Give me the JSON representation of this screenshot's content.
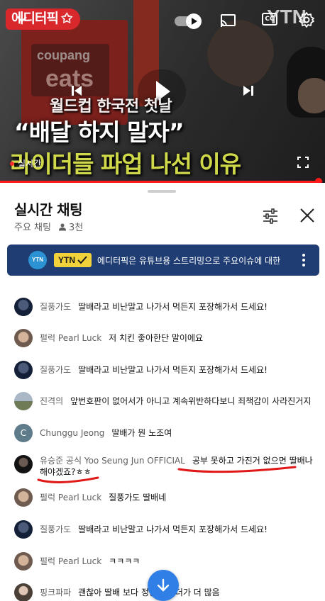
{
  "video": {
    "channel_logo": "에디터픽",
    "watermark": "YTN",
    "subtitle_line1": "월드컵 한국전 첫날",
    "subtitle_line2": "“배달 하지 말자”",
    "subtitle_line3": "라이더들 파업 나선 이유",
    "live_label": "실시간",
    "progress": 0.98,
    "icons": [
      "chevron-down-icon",
      "autoplay-toggle",
      "cast-icon",
      "captions-icon",
      "settings-gear-icon",
      "previous-icon",
      "play-icon",
      "next-icon",
      "fullscreen-icon"
    ],
    "colors": {
      "accent": "#ff1a1a",
      "logo_bg": "#d8282c",
      "subtitle_yellow": "#cfd94a"
    }
  },
  "chat": {
    "title": "실시간 채팅",
    "mode": "주요 채팅",
    "viewers": "3천",
    "pinned": {
      "avatar_text": "YTN",
      "badge": "YTN",
      "text": "에디터픽은 유튜브용 스트리밍으로 주요이슈에 대한 방"
    },
    "messages": [
      {
        "author": "질풍가도",
        "text": "딸배라고 비난말고 나가서 먹든지 포장해가서 드세요!",
        "avatar": "dark"
      },
      {
        "author": "펄럭 Pearl Luck",
        "text": "저 치킨 좋아한단 말이에요",
        "avatar": "face"
      },
      {
        "author": "질풍가도",
        "text": "딸배라고 비난말고 나가서 먹든지 포장해가서 드세요!",
        "avatar": "dark"
      },
      {
        "author": "진격의",
        "text": "앞번호판이 없어서가 아니고 계속위반하다보니 죄책감이 사라진거지",
        "avatar": "land"
      },
      {
        "author": "Chunggu Jeong",
        "text": "딸배가 뭔 노조여",
        "avatar": "C"
      },
      {
        "author": "유승준 공식 Yoo Seung Jun OFFICIAL",
        "text": "공부 못하고 가진거 없으면 딸배나 해야겠죠?ㅎㅎ",
        "avatar": "black"
      },
      {
        "author": "펄럭 Pearl Luck",
        "text": "질풍가도 딸배네",
        "avatar": "face"
      },
      {
        "author": "질풍가도",
        "text": "딸배라고 비난말고 나가서 먹든지 포장해가서 드세요!",
        "avatar": "dark"
      },
      {
        "author": "펄럭 Pearl Luck",
        "text": "ㅋㅋㅋㅋ",
        "avatar": "face"
      },
      {
        "author": "핑크파파",
        "text": "괜찮아 딸배 보다 정상 라이더가 더 많음",
        "avatar": "pink"
      }
    ],
    "icons": [
      "filter-icon",
      "close-icon",
      "more-vert-icon",
      "arrow-down-icon"
    ],
    "colors": {
      "pinned_bg": "#1f3d72",
      "badge": "#f2d23a",
      "scroll_button": "#2f7fe6",
      "annotation": "#e01818"
    }
  }
}
